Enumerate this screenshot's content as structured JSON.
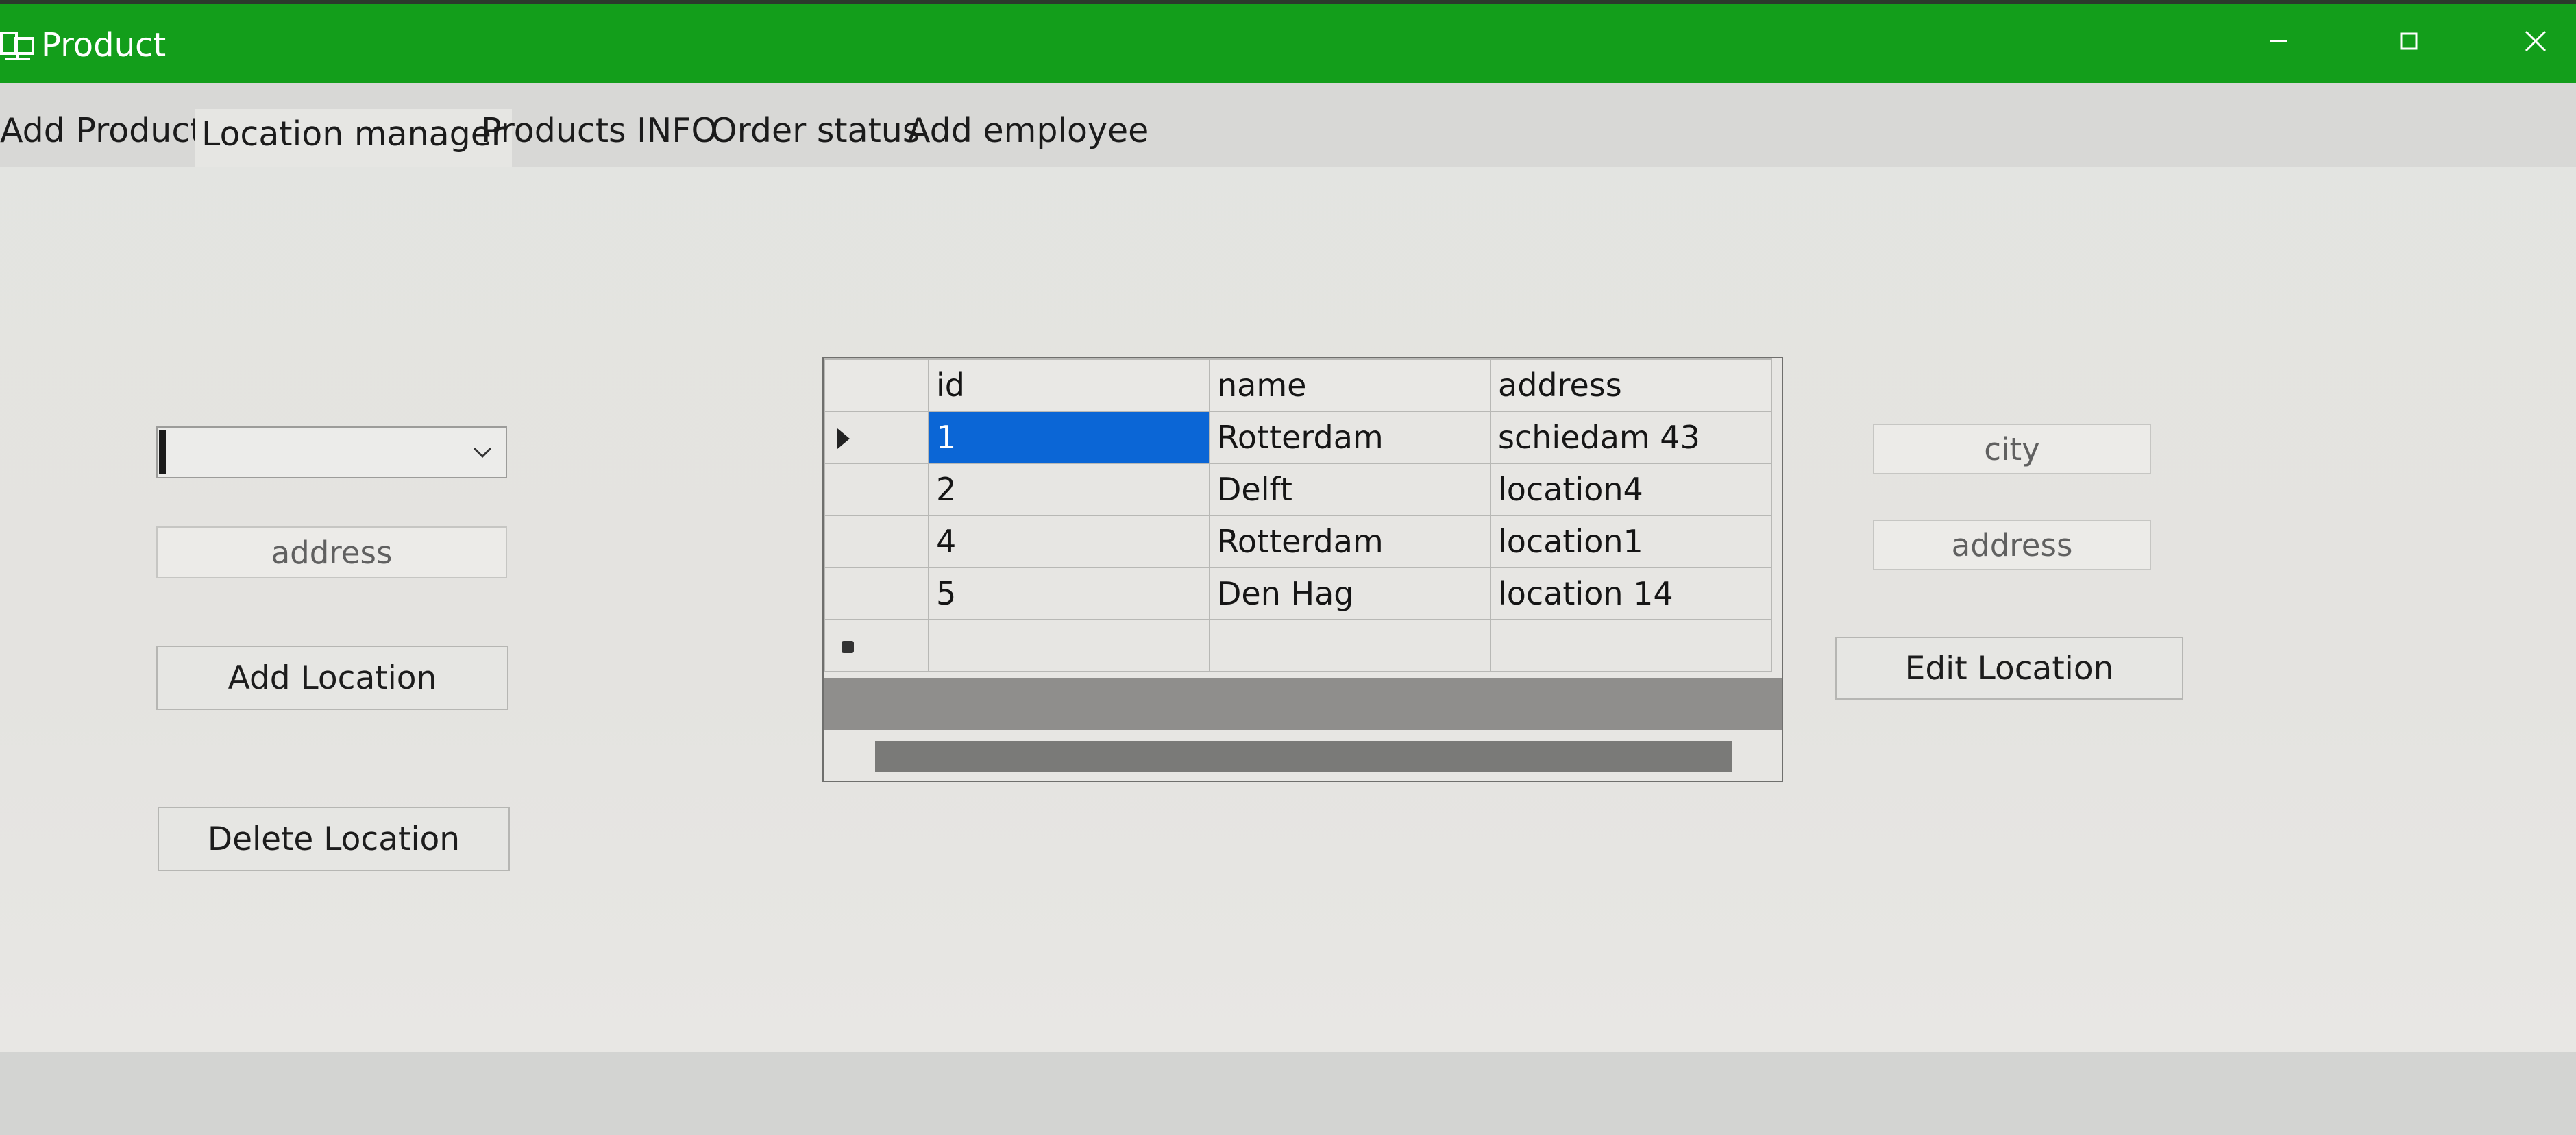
{
  "window": {
    "title": "Product",
    "icon": "app-window-icon",
    "controls": [
      "minimize-icon",
      "maximize-icon",
      "close-icon"
    ],
    "titlebar_color": "#139e1b"
  },
  "tabs": [
    {
      "label": "Add Product",
      "active": false
    },
    {
      "label": "Location manager",
      "active": true
    },
    {
      "label": "Products INFO",
      "active": false
    },
    {
      "label": "Order status",
      "active": false
    },
    {
      "label": "Add employee",
      "active": false
    }
  ],
  "left_panel": {
    "dropdown_value": "",
    "address_placeholder": "address",
    "add_button": "Add Location",
    "delete_button": "Delete Location"
  },
  "right_panel": {
    "city_placeholder": "city",
    "address_placeholder": "address",
    "edit_button": "Edit Location"
  },
  "grid": {
    "columns": [
      "id",
      "name",
      "address"
    ],
    "rows": [
      {
        "id": "1",
        "name": "Rotterdam",
        "address": "schiedam 43",
        "current": true
      },
      {
        "id": "2",
        "name": "Delft",
        "address": "location4",
        "current": false
      },
      {
        "id": "4",
        "name": "Rotterdam",
        "address": "location1",
        "current": false
      },
      {
        "id": "5",
        "name": "Den Hag",
        "address": "location 14",
        "current": false
      }
    ],
    "selection_color": "#0b66d6"
  }
}
